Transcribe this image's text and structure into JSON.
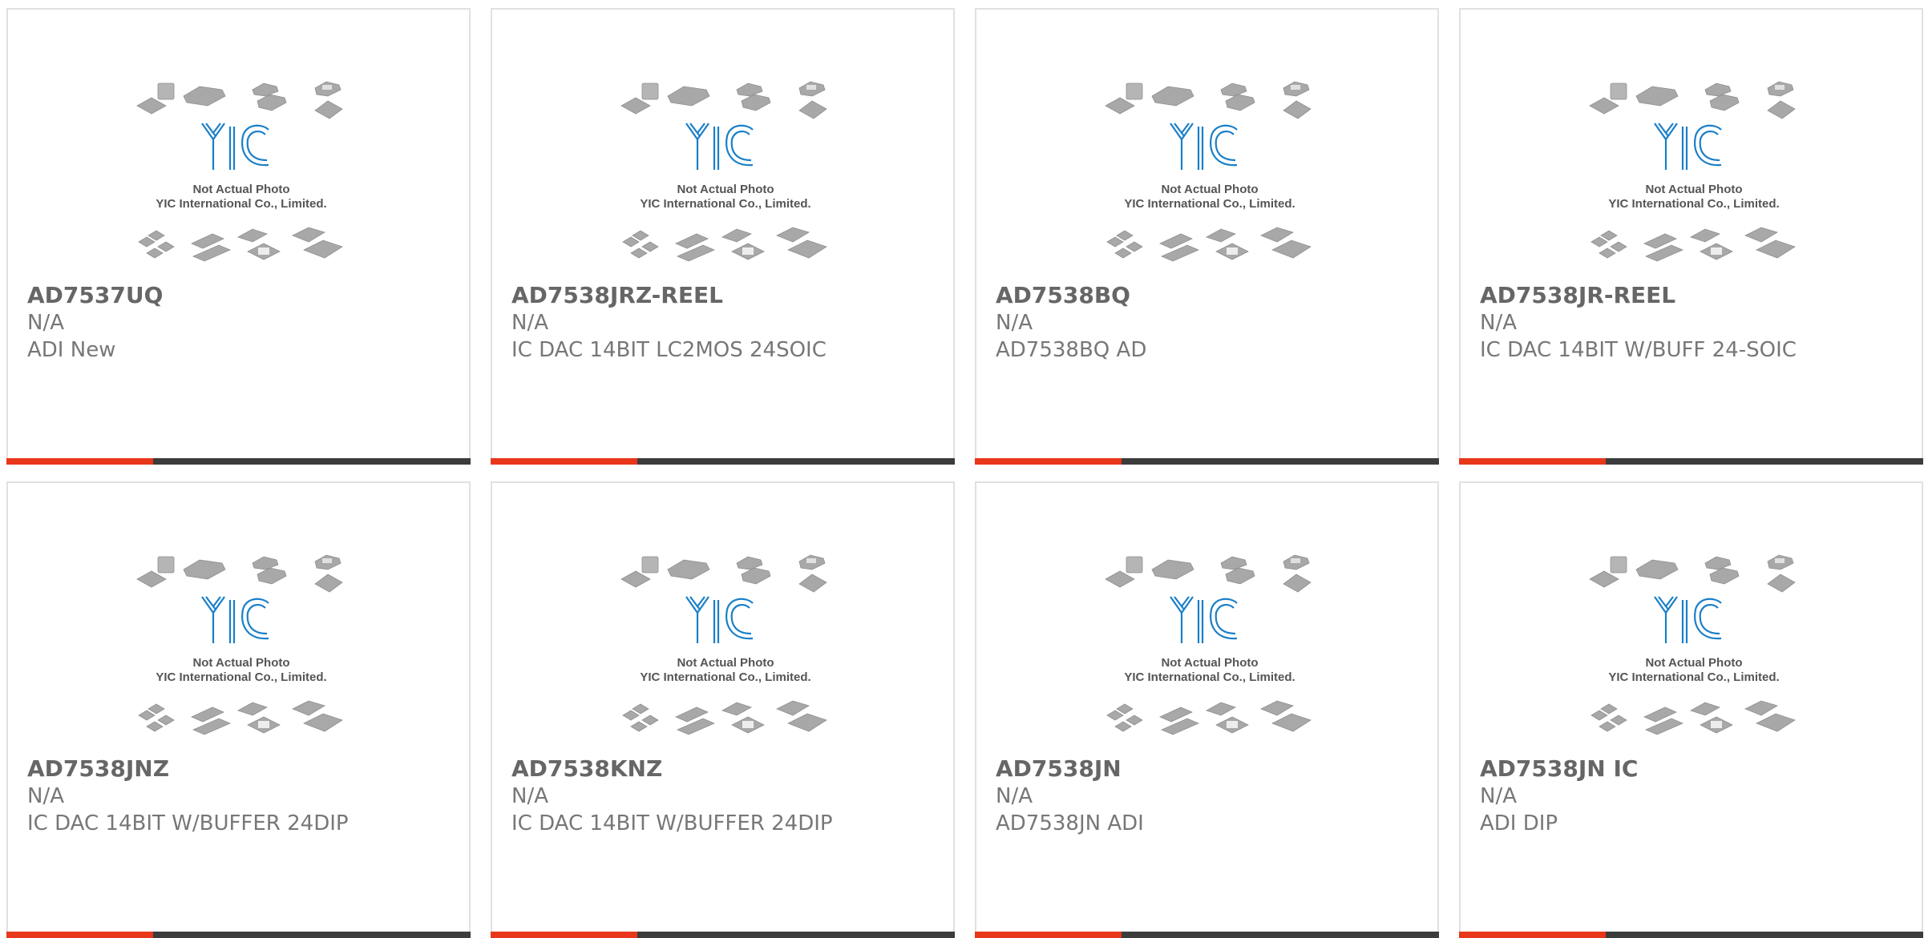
{
  "placeholder_photo": {
    "caption_line1": "Not Actual Photo",
    "caption_line2": "YIC International Co., Limited.",
    "logo_text": "YIC",
    "logo_color": "#1a7fc8"
  },
  "colors": {
    "accent": "#e8371a",
    "bar_dark": "#3c3c3c",
    "text_gray": "#666666"
  },
  "products": [
    {
      "part_number": "AD7537UQ",
      "line1": "N/A",
      "line2": "ADI New"
    },
    {
      "part_number": "AD7538JRZ-REEL",
      "line1": "N/A",
      "line2": "IC DAC 14BIT LC2MOS 24SOIC"
    },
    {
      "part_number": "AD7538BQ",
      "line1": "N/A",
      "line2": "AD7538BQ AD"
    },
    {
      "part_number": "AD7538JR-REEL",
      "line1": "N/A",
      "line2": "IC DAC 14BIT W/BUFF 24-SOIC"
    },
    {
      "part_number": "AD7538JNZ",
      "line1": "N/A",
      "line2": "IC DAC 14BIT W/BUFFER 24DIP"
    },
    {
      "part_number": "AD7538KNZ",
      "line1": "N/A",
      "line2": "IC DAC 14BIT W/BUFFER 24DIP"
    },
    {
      "part_number": "AD7538JN",
      "line1": "N/A",
      "line2": "AD7538JN ADI"
    },
    {
      "part_number": "AD7538JN IC",
      "line1": "N/A",
      "line2": "ADI DIP"
    }
  ]
}
